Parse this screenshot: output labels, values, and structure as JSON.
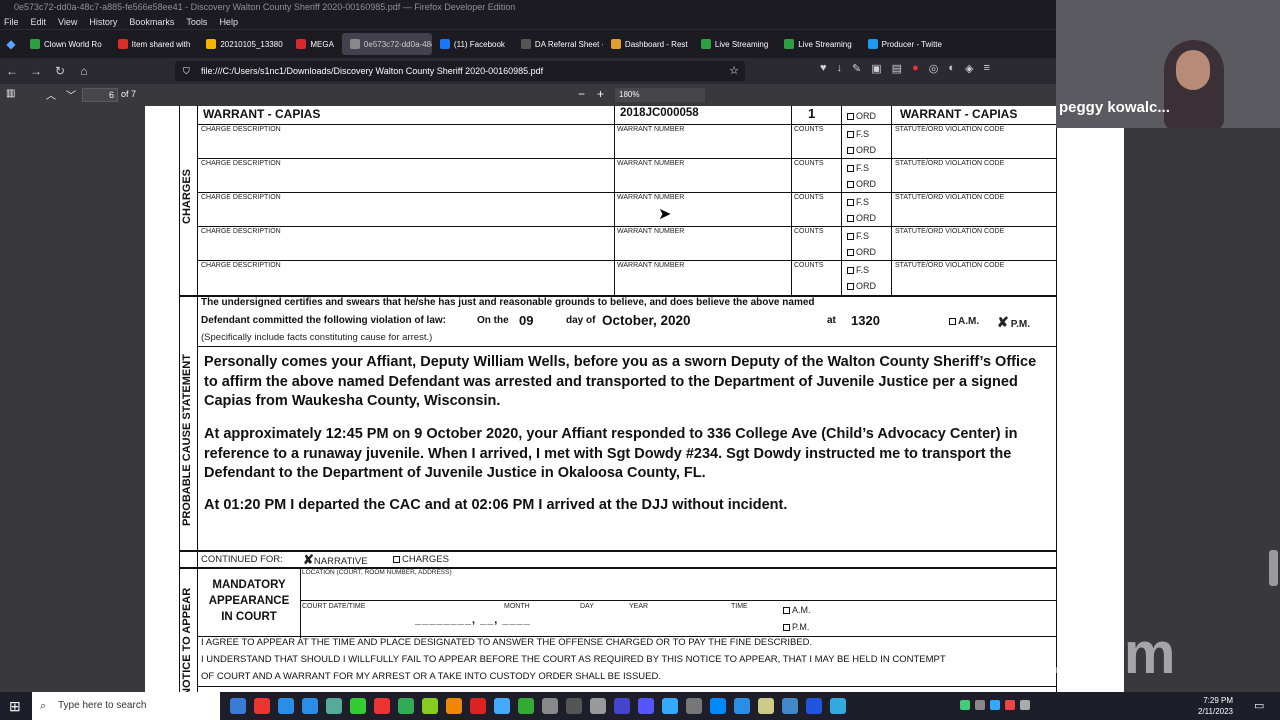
{
  "browser": {
    "window_title": "0e573c72-dd0a-48c7-a885-fe566e58ee41 - Discovery Walton County Sheriff 2020-00160985.pdf — Firefox Developer Edition",
    "menu": [
      "File",
      "Edit",
      "View",
      "History",
      "Bookmarks",
      "Tools",
      "Help"
    ],
    "tabs": [
      {
        "label": "Clown World Ro",
        "color": "#2ea043"
      },
      {
        "label": "Item shared with",
        "color": "#d93025"
      },
      {
        "label": "20210105_13380",
        "color": "#f4b400"
      },
      {
        "label": "MEGA",
        "color": "#d9272e"
      },
      {
        "label": "0e573c72-dd0a-48c",
        "color": "#888888"
      },
      {
        "label": "(11) Facebook",
        "color": "#1877f2"
      },
      {
        "label": "DA Referral Sheet - D",
        "color": "#555555"
      },
      {
        "label": "Dashboard - Rest",
        "color": "#e0a030"
      },
      {
        "label": "Live Streaming",
        "color": "#2ea043"
      },
      {
        "label": "Live Streaming",
        "color": "#2ea043"
      },
      {
        "label": "Producer - Twitte",
        "color": "#1d9bf0"
      }
    ],
    "url": "file:///C:/Users/s1nc1/Downloads/Discovery Walton County Sheriff 2020-00160985.pdf"
  },
  "pdf_toolbar": {
    "page_number": "6",
    "page_total": "of 7",
    "zoom": "180%"
  },
  "form": {
    "top_row": {
      "charge": "WARRANT - CAPIAS",
      "warrant_number": "2018JC000058",
      "counts": "1",
      "ord": "ORD",
      "statute": "WARRANT - CAPIAS"
    },
    "labels": {
      "charge_description": "CHARGE DESCRIPTION",
      "warrant_number": "WARRANT NUMBER",
      "counts": "COUNTS",
      "fs": "F.S",
      "ord": "ORD",
      "statute": "STATUTE/ORD VIOLATION CODE",
      "charges_side": "CHARGES",
      "probable_cause_side": "PROBABLE CAUSE STATEMENT",
      "notice_side": "NOTICE TO APPEAR"
    },
    "certify_line1": "The undersigned certifies and swears that he/she has just and reasonable grounds to believe, and does believe the above named",
    "certify_line2a": "Defendant committed the following violation of law:",
    "on_the": "On the",
    "day": "09",
    "day_of": "day of",
    "month_year": "October, 2020",
    "at": "at",
    "time": "1320",
    "am": "A.M.",
    "pm": "P.M.",
    "specifically": "(Specifically include facts constituting cause for arrest.)",
    "narrative_p1": "Personally comes your Affiant, Deputy William Wells, before you as a sworn Deputy of the Walton County Sheriff’s Office to affirm the above named Defendant was arrested and transported to the Department of Juvenile Justice per a signed Capias from Waukesha County, Wisconsin.",
    "narrative_p2": "At approximately 12:45 PM on 9 October 2020, your Affiant responded to 336 College Ave (Child’s Advocacy Center) in reference to a runaway juvenile. When I arrived, I met with Sgt Dowdy #234. Sgt Dowdy instructed me to transport the Defendant to the Department of Juvenile Justice in Okaloosa County, FL.",
    "narrative_p3": "At 01:20 PM I departed the CAC and at 02:06 PM I arrived at the DJJ without incident.",
    "continued_for": "CONTINUED FOR:",
    "narrative": "NARRATIVE",
    "charges": "CHARGES",
    "mandatory": "MANDATORY APPEARANCE IN COURT",
    "location": "LOCATION (COURT, ROOM NUMBER, ADDRESS)",
    "court_date": "COURT DATE/TIME",
    "month": "MONTH",
    "day_lbl": "DAY",
    "year": "YEAR",
    "time_lbl": "TIME",
    "am2": "A.M.",
    "pm2": "P.M.",
    "agree1": "I AGREE TO APPEAR AT THE TIME AND PLACE DESIGNATED TO ANSWER THE OFFENSE CHARGED OR TO PAY THE FINE DESCRIBED.",
    "agree2": "I UNDERSTAND THAT SHOULD I WILLFULLY FAIL TO APPEAR BEFORE THE COURT AS REQUIRED BY THIS NOTICE TO APPEAR, THAT I MAY BE HELD IN CONTEMPT",
    "agree3": "OF COURT AND A WARRANT FOR MY ARREST OR A TAKE INTO CUSTODY ORDER SHALL BE ISSUED."
  },
  "zoom_overlay": {
    "participant": "peggy kowalc...",
    "logo": "zoom"
  },
  "taskbar": {
    "search_placeholder": "Type here to search",
    "time": "7:29 PM",
    "date": "2/11/2023"
  }
}
